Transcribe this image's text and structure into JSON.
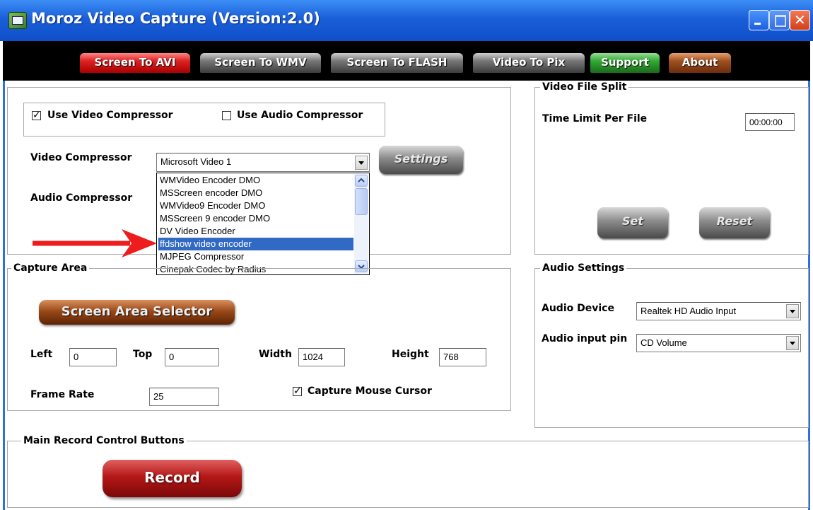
{
  "window": {
    "title": "Moroz Video Capture (Version:2.0)"
  },
  "tabs": [
    {
      "label": "Screen To AVI",
      "color": "#cc2222"
    },
    {
      "label": "Screen To WMV",
      "color": "#555555"
    },
    {
      "label": "Screen To FLASH",
      "color": "#555555"
    },
    {
      "label": "Video To Pix",
      "color": "#555555"
    },
    {
      "label": "Support",
      "color": "#2e8b2e"
    },
    {
      "label": "About",
      "color": "#8b4513"
    }
  ],
  "compression": {
    "use_video_compressor": {
      "label": "Use Video Compressor",
      "checked": true
    },
    "use_audio_compressor": {
      "label": "Use Audio Compressor",
      "checked": false
    },
    "video_label": "Video Compressor",
    "audio_label": "Audio Compressor",
    "video_selected": "Microsoft Video 1",
    "settings_label": "Settings",
    "dropdown_items": [
      "WMVideo Encoder DMO",
      "MSScreen encoder DMO",
      "WMVideo9 Encoder DMO",
      "MSScreen 9 encoder DMO",
      "DV Video Encoder",
      "ffdshow video encoder",
      "MJPEG Compressor",
      "Cinepak Codec by Radius"
    ],
    "highlighted_item": "ffdshow video encoder"
  },
  "split": {
    "legend": "Video File Split",
    "time_label": "Time Limit Per  File",
    "time_value": "00:00:00",
    "set_label": "Set",
    "reset_label": "Reset"
  },
  "capture": {
    "legend": "Capture Area",
    "selector_label": "Screen Area Selector",
    "left_label": "Left",
    "left_value": "0",
    "top_label": "Top",
    "top_value": "0",
    "width_label": "Width",
    "width_value": "1024",
    "height_label": "Height",
    "height_value": "768",
    "framerate_label": "Frame Rate",
    "framerate_value": "25",
    "mouse_label": "Capture Mouse Cursor",
    "mouse_checked": true
  },
  "audio": {
    "legend": "Audio Settings",
    "device_label": "Audio Device",
    "device_value": "Realtek HD Audio Input",
    "pin_label": "Audio input pin",
    "pin_value": "CD Volume"
  },
  "record": {
    "legend": "Main Record Control Buttons",
    "record_label": "Record"
  }
}
